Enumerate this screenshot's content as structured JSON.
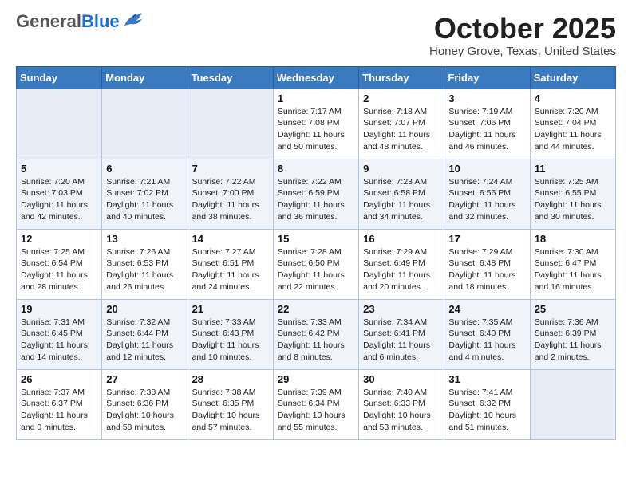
{
  "header": {
    "logo_general": "General",
    "logo_blue": "Blue",
    "month_title": "October 2025",
    "location": "Honey Grove, Texas, United States"
  },
  "days_of_week": [
    "Sunday",
    "Monday",
    "Tuesday",
    "Wednesday",
    "Thursday",
    "Friday",
    "Saturday"
  ],
  "weeks": [
    [
      {
        "day": "",
        "info": ""
      },
      {
        "day": "",
        "info": ""
      },
      {
        "day": "",
        "info": ""
      },
      {
        "day": "1",
        "info": "Sunrise: 7:17 AM\nSunset: 7:08 PM\nDaylight: 11 hours\nand 50 minutes."
      },
      {
        "day": "2",
        "info": "Sunrise: 7:18 AM\nSunset: 7:07 PM\nDaylight: 11 hours\nand 48 minutes."
      },
      {
        "day": "3",
        "info": "Sunrise: 7:19 AM\nSunset: 7:06 PM\nDaylight: 11 hours\nand 46 minutes."
      },
      {
        "day": "4",
        "info": "Sunrise: 7:20 AM\nSunset: 7:04 PM\nDaylight: 11 hours\nand 44 minutes."
      }
    ],
    [
      {
        "day": "5",
        "info": "Sunrise: 7:20 AM\nSunset: 7:03 PM\nDaylight: 11 hours\nand 42 minutes."
      },
      {
        "day": "6",
        "info": "Sunrise: 7:21 AM\nSunset: 7:02 PM\nDaylight: 11 hours\nand 40 minutes."
      },
      {
        "day": "7",
        "info": "Sunrise: 7:22 AM\nSunset: 7:00 PM\nDaylight: 11 hours\nand 38 minutes."
      },
      {
        "day": "8",
        "info": "Sunrise: 7:22 AM\nSunset: 6:59 PM\nDaylight: 11 hours\nand 36 minutes."
      },
      {
        "day": "9",
        "info": "Sunrise: 7:23 AM\nSunset: 6:58 PM\nDaylight: 11 hours\nand 34 minutes."
      },
      {
        "day": "10",
        "info": "Sunrise: 7:24 AM\nSunset: 6:56 PM\nDaylight: 11 hours\nand 32 minutes."
      },
      {
        "day": "11",
        "info": "Sunrise: 7:25 AM\nSunset: 6:55 PM\nDaylight: 11 hours\nand 30 minutes."
      }
    ],
    [
      {
        "day": "12",
        "info": "Sunrise: 7:25 AM\nSunset: 6:54 PM\nDaylight: 11 hours\nand 28 minutes."
      },
      {
        "day": "13",
        "info": "Sunrise: 7:26 AM\nSunset: 6:53 PM\nDaylight: 11 hours\nand 26 minutes."
      },
      {
        "day": "14",
        "info": "Sunrise: 7:27 AM\nSunset: 6:51 PM\nDaylight: 11 hours\nand 24 minutes."
      },
      {
        "day": "15",
        "info": "Sunrise: 7:28 AM\nSunset: 6:50 PM\nDaylight: 11 hours\nand 22 minutes."
      },
      {
        "day": "16",
        "info": "Sunrise: 7:29 AM\nSunset: 6:49 PM\nDaylight: 11 hours\nand 20 minutes."
      },
      {
        "day": "17",
        "info": "Sunrise: 7:29 AM\nSunset: 6:48 PM\nDaylight: 11 hours\nand 18 minutes."
      },
      {
        "day": "18",
        "info": "Sunrise: 7:30 AM\nSunset: 6:47 PM\nDaylight: 11 hours\nand 16 minutes."
      }
    ],
    [
      {
        "day": "19",
        "info": "Sunrise: 7:31 AM\nSunset: 6:45 PM\nDaylight: 11 hours\nand 14 minutes."
      },
      {
        "day": "20",
        "info": "Sunrise: 7:32 AM\nSunset: 6:44 PM\nDaylight: 11 hours\nand 12 minutes."
      },
      {
        "day": "21",
        "info": "Sunrise: 7:33 AM\nSunset: 6:43 PM\nDaylight: 11 hours\nand 10 minutes."
      },
      {
        "day": "22",
        "info": "Sunrise: 7:33 AM\nSunset: 6:42 PM\nDaylight: 11 hours\nand 8 minutes."
      },
      {
        "day": "23",
        "info": "Sunrise: 7:34 AM\nSunset: 6:41 PM\nDaylight: 11 hours\nand 6 minutes."
      },
      {
        "day": "24",
        "info": "Sunrise: 7:35 AM\nSunset: 6:40 PM\nDaylight: 11 hours\nand 4 minutes."
      },
      {
        "day": "25",
        "info": "Sunrise: 7:36 AM\nSunset: 6:39 PM\nDaylight: 11 hours\nand 2 minutes."
      }
    ],
    [
      {
        "day": "26",
        "info": "Sunrise: 7:37 AM\nSunset: 6:37 PM\nDaylight: 11 hours\nand 0 minutes."
      },
      {
        "day": "27",
        "info": "Sunrise: 7:38 AM\nSunset: 6:36 PM\nDaylight: 10 hours\nand 58 minutes."
      },
      {
        "day": "28",
        "info": "Sunrise: 7:38 AM\nSunset: 6:35 PM\nDaylight: 10 hours\nand 57 minutes."
      },
      {
        "day": "29",
        "info": "Sunrise: 7:39 AM\nSunset: 6:34 PM\nDaylight: 10 hours\nand 55 minutes."
      },
      {
        "day": "30",
        "info": "Sunrise: 7:40 AM\nSunset: 6:33 PM\nDaylight: 10 hours\nand 53 minutes."
      },
      {
        "day": "31",
        "info": "Sunrise: 7:41 AM\nSunset: 6:32 PM\nDaylight: 10 hours\nand 51 minutes."
      },
      {
        "day": "",
        "info": ""
      }
    ]
  ]
}
